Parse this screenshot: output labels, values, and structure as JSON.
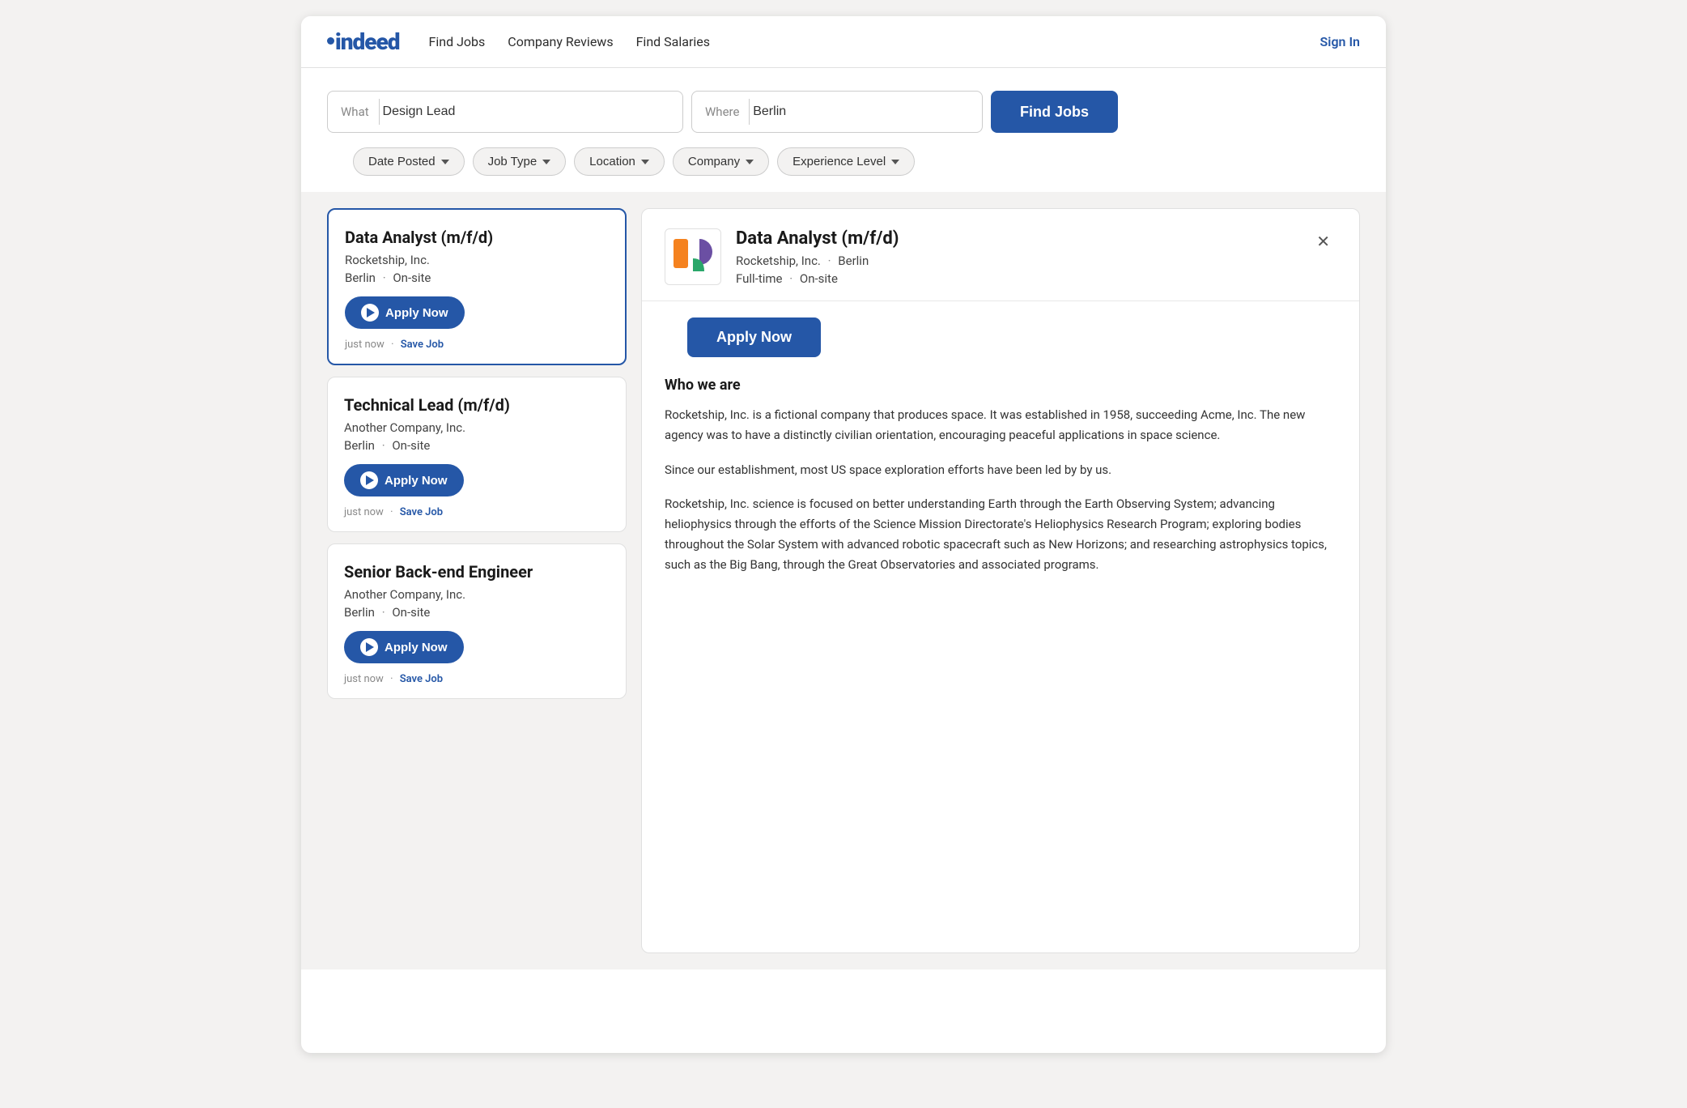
{
  "nav": {
    "logo": "indeed",
    "links": [
      "Find Jobs",
      "Company Reviews",
      "Find Salaries"
    ],
    "sign_in": "Sign In"
  },
  "search": {
    "what_label": "What",
    "what_value": "Design Lead",
    "where_label": "Where",
    "where_value": "Berlin",
    "find_jobs_btn": "Find Jobs"
  },
  "filters": [
    {
      "label": "Date Posted"
    },
    {
      "label": "Job Type"
    },
    {
      "label": "Location"
    },
    {
      "label": "Company"
    },
    {
      "label": "Experience Level"
    }
  ],
  "jobs": [
    {
      "title": "Data Analyst (m/f/d)",
      "company": "Rocketship, Inc.",
      "location": "Berlin",
      "work_type": "On-site",
      "apply_label": "Apply Now",
      "time_posted": "just now",
      "save_label": "Save Job",
      "selected": true
    },
    {
      "title": "Technical Lead (m/f/d)",
      "company": "Another Company, Inc.",
      "location": "Berlin",
      "work_type": "On-site",
      "apply_label": "Apply Now",
      "time_posted": "just now",
      "save_label": "Save Job",
      "selected": false
    },
    {
      "title": "Senior Back-end Engineer",
      "company": "Another Company, Inc.",
      "location": "Berlin",
      "work_type": "On-site",
      "apply_label": "Apply Now",
      "time_posted": "just now",
      "save_label": "Save Job",
      "selected": false
    }
  ],
  "detail": {
    "title": "Data Analyst (m/f/d)",
    "company": "Rocketship, Inc.",
    "location": "Berlin",
    "job_type": "Full-time",
    "work_type": "On-site",
    "apply_label": "Apply Now",
    "who_we_are_title": "Who we are",
    "paragraphs": [
      "Rocketship, Inc. is a fictional company that produces space. It was established in 1958, succeeding Acme, Inc. The new agency was to have a distinctly civilian orientation, encouraging peaceful applications in space science.",
      "Since our establishment, most US space exploration efforts have been led by by us.",
      "Rocketship, Inc. science is focused on better understanding Earth through the Earth Observing System; advancing heliophysics through the efforts of the Science Mission Directorate's Heliophysics Research Program; exploring bodies throughout the Solar System with advanced robotic spacecraft such as New Horizons; and researching astrophysics topics, such as the Big Bang, through the Great Observatories and associated programs."
    ]
  }
}
